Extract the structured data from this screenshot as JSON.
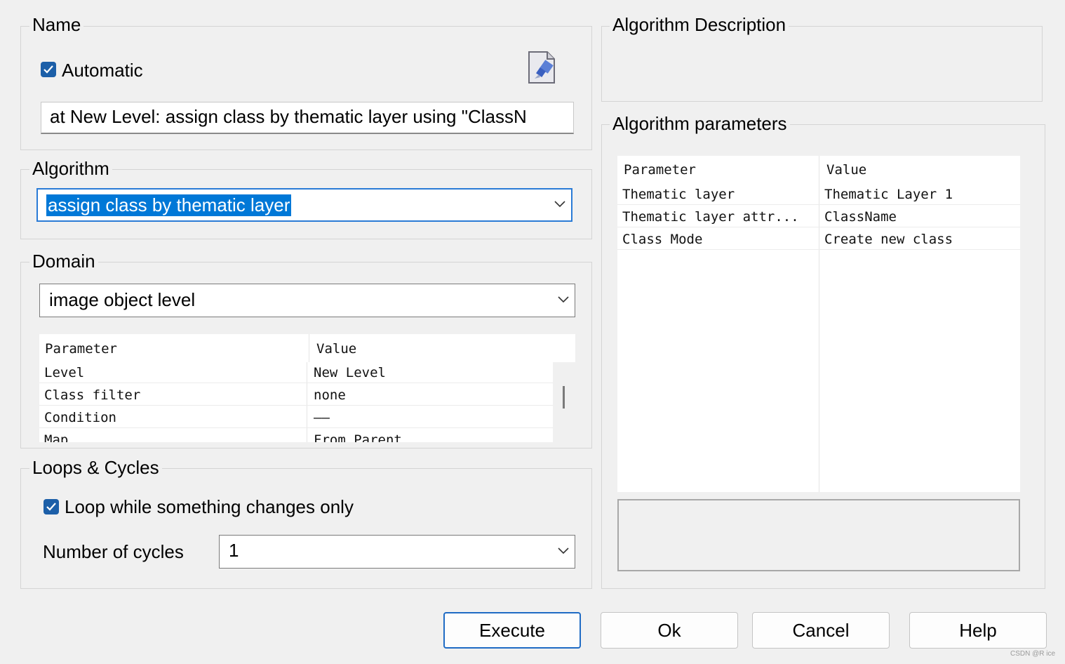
{
  "name_group": {
    "title": "Name",
    "automatic_label": "Automatic",
    "name_value": "at  New Level: assign class by thematic layer using \"ClassN"
  },
  "algorithm_group": {
    "title": "Algorithm",
    "selected": "assign class by thematic layer"
  },
  "domain_group": {
    "title": "Domain",
    "selected": "image object level",
    "params": {
      "header_param": "Parameter",
      "header_value": "Value",
      "rows": [
        {
          "param": "Level",
          "value": "New Level"
        },
        {
          "param": "Class filter",
          "value": "none"
        },
        {
          "param": "Condition",
          "value": "——"
        },
        {
          "param": "Map",
          "value": "From Parent"
        }
      ]
    }
  },
  "loops_group": {
    "title": "Loops & Cycles",
    "loop_label": "Loop while something changes only",
    "cycles_label": "Number of cycles",
    "cycles_value": "1"
  },
  "description_group": {
    "title": "Algorithm Description"
  },
  "algo_params_group": {
    "title": "Algorithm parameters",
    "header_param": "Parameter",
    "header_value": "Value",
    "rows": [
      {
        "param": "Thematic layer",
        "value": "Thematic Layer 1"
      },
      {
        "param": "Thematic layer attr...",
        "value": "ClassName"
      },
      {
        "param": "Class Mode",
        "value": "Create new class"
      }
    ]
  },
  "buttons": {
    "execute": "Execute",
    "ok": "Ok",
    "cancel": "Cancel",
    "help": "Help"
  },
  "watermark": "CSDN @R ice",
  "colors": {
    "accent": "#1c5fa8",
    "selection": "#0078d7",
    "background": "#f0f0f0"
  },
  "icons": {
    "name_editor": "document-edit-icon",
    "dropdown": "chevron-down-icon"
  }
}
